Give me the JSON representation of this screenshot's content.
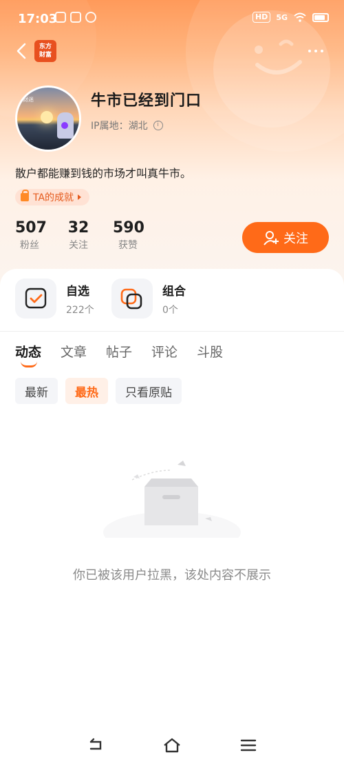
{
  "status_bar": {
    "time": "17:03",
    "hd": "HD",
    "net": "5G"
  },
  "header": {
    "logo_text_line1": "东方",
    "logo_text_line2": "财富"
  },
  "profile": {
    "username": "牛市已经到门口",
    "ip_label": "IP属地：湖北",
    "bio": "散户都能赚到钱的市场才叫真牛市。",
    "achievement": "TA的成就",
    "avatar_text": "财迷"
  },
  "stats": [
    {
      "value": "507",
      "label": "粉丝"
    },
    {
      "value": "32",
      "label": "关注"
    },
    {
      "value": "590",
      "label": "获赞"
    }
  ],
  "follow_button": "关注",
  "shortcuts": [
    {
      "title": "自选",
      "sub": "222个"
    },
    {
      "title": "组合",
      "sub": "0个"
    }
  ],
  "tabs": [
    {
      "label": "动态",
      "active": true
    },
    {
      "label": "文章",
      "active": false
    },
    {
      "label": "帖子",
      "active": false
    },
    {
      "label": "评论",
      "active": false
    },
    {
      "label": "斗股",
      "active": false
    }
  ],
  "filters": [
    {
      "label": "最新",
      "active": false
    },
    {
      "label": "最热",
      "active": true
    },
    {
      "label": "只看原贴",
      "active": false
    }
  ],
  "empty_message": "你已被该用户拉黑，该处内容不展示",
  "colors": {
    "accent": "#ff6a18",
    "logo": "#e8501f"
  }
}
